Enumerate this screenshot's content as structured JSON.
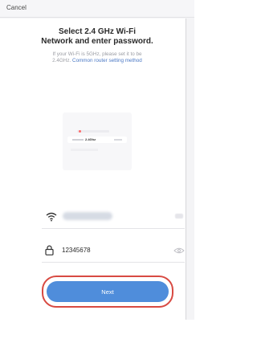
{
  "header": {
    "cancel_label": "Cancel"
  },
  "main": {
    "title_line1": "Select 2.4 GHz Wi-Fi",
    "title_line2": "Network and enter password.",
    "subtitle_line1": "If your Wi-Fi is 5GHz, please set it to be",
    "subtitle_line2_prefix": "2.4GHz.",
    "subtitle_link": "Common router setting method"
  },
  "illustration": {
    "selected_network_label": "2.4Ghz"
  },
  "form": {
    "ssid_value": "",
    "password_value": "12345678"
  },
  "actions": {
    "next_label": "Next"
  },
  "colors": {
    "accent": "#4f8ddb",
    "highlight": "#d84a42",
    "link": "#4a78c4"
  },
  "icons": {
    "wifi": "wifi-icon",
    "lock": "lock-icon",
    "eye": "eye-icon"
  }
}
